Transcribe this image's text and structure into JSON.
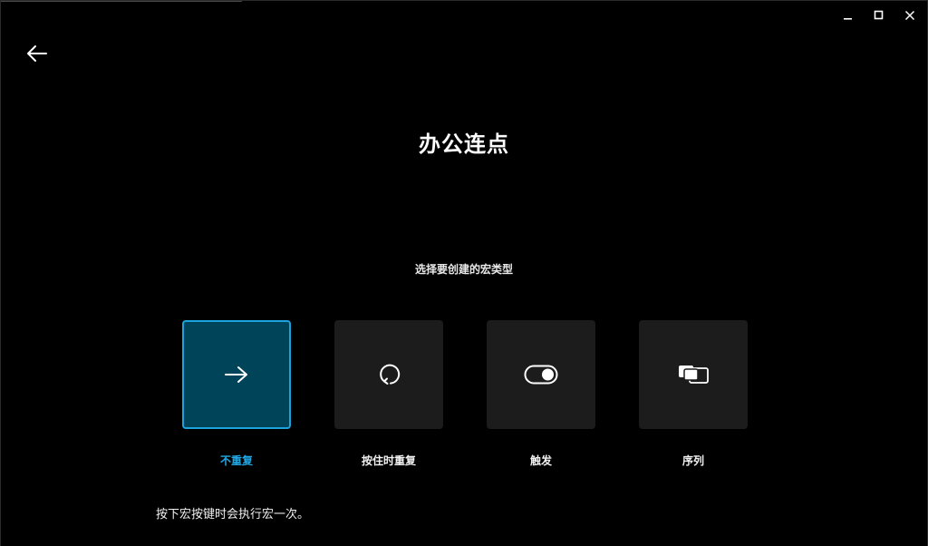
{
  "window": {
    "controls": [
      {
        "name": "minimize-icon",
        "label": "minimize"
      },
      {
        "name": "maximize-icon",
        "label": "maximize"
      },
      {
        "name": "close-icon",
        "label": "close"
      }
    ]
  },
  "nav": {
    "back_icon": "arrow-left-icon"
  },
  "page": {
    "title": "办公连点",
    "subtitle": "选择要创建的宏类型"
  },
  "macro_types": [
    {
      "label": "不重复",
      "icon": "arrow-right-icon",
      "selected": true
    },
    {
      "label": "按住时重复",
      "icon": "repeat-icon",
      "selected": false
    },
    {
      "label": "触发",
      "icon": "toggle-icon",
      "selected": false
    },
    {
      "label": "序列",
      "icon": "sequence-icon",
      "selected": false
    }
  ],
  "description": "按下宏按键时会执行宏一次。",
  "colors": {
    "background": "#000000",
    "tile": "#1c1c1c",
    "selected_tile": "#00445a",
    "selected_border": "#1aa3dc",
    "selected_label": "#22a8e6"
  }
}
